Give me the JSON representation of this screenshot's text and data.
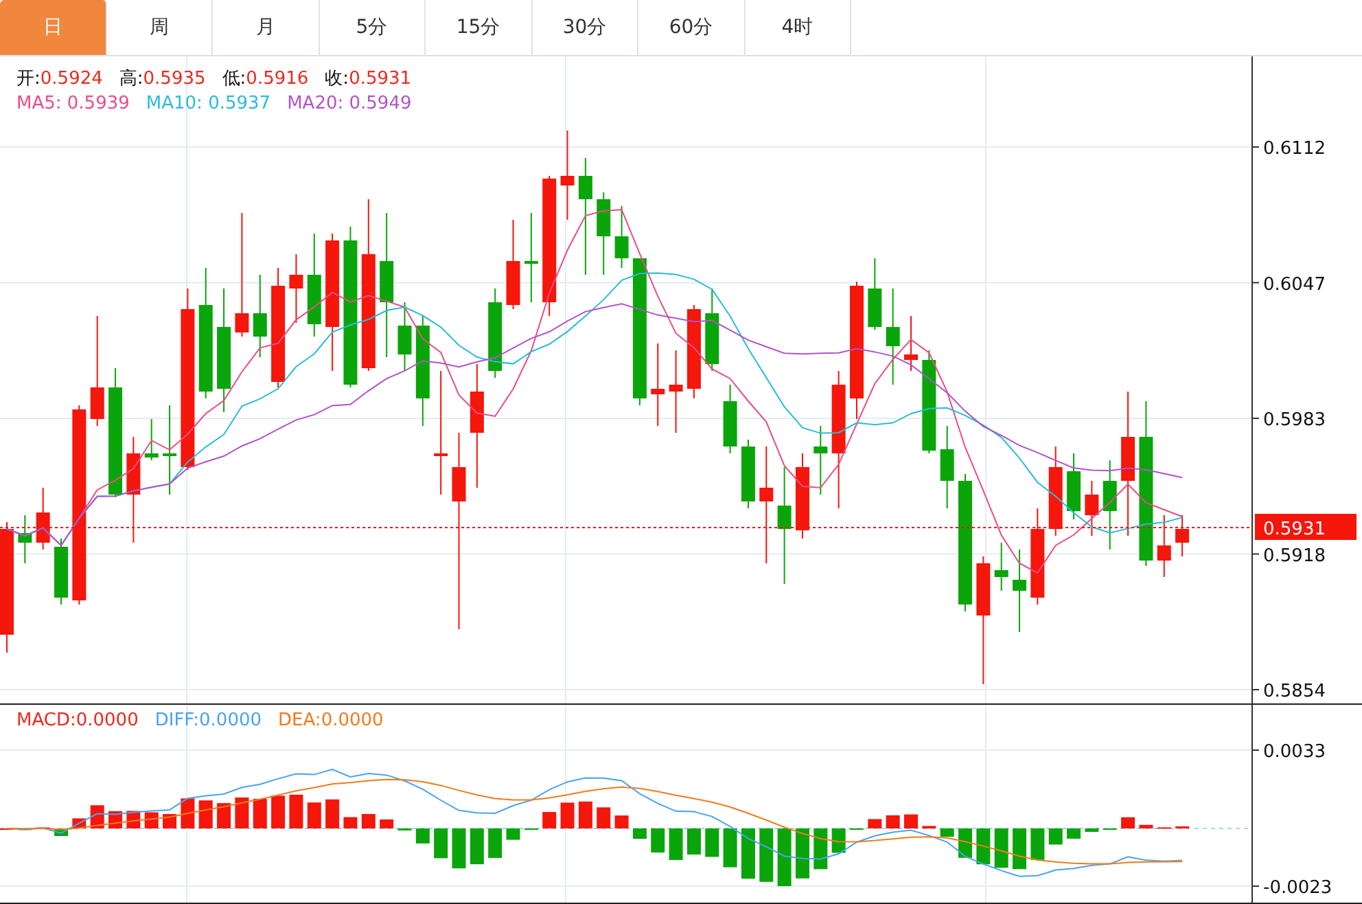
{
  "tabs": [
    {
      "label": "日",
      "selected": true
    },
    {
      "label": "周",
      "selected": false
    },
    {
      "label": "月",
      "selected": false
    },
    {
      "label": "5分",
      "selected": false
    },
    {
      "label": "15分",
      "selected": false
    },
    {
      "label": "30分",
      "selected": false
    },
    {
      "label": "60分",
      "selected": false
    },
    {
      "label": "4时",
      "selected": false
    }
  ],
  "price_panel": {
    "ohlc": [
      {
        "label": "开:",
        "value": "0.5924"
      },
      {
        "label": "高:",
        "value": "0.5935"
      },
      {
        "label": "低:",
        "value": "0.5916"
      },
      {
        "label": "收:",
        "value": "0.5931"
      }
    ],
    "moving_averages": [
      {
        "label": "MA5:",
        "value": "0.5939",
        "color": "#ea4c89"
      },
      {
        "label": "MA10:",
        "value": "0.5937",
        "color": "#2bbcd6"
      },
      {
        "label": "MA20:",
        "value": "0.5949",
        "color": "#b154c8"
      }
    ],
    "y_ticks": [
      "0.6112",
      "0.6047",
      "0.5983",
      "0.5918",
      "0.5854"
    ],
    "last_price": "0.5931"
  },
  "macd_panel": {
    "indicators": [
      {
        "label": "MACD:",
        "value": "0.0000",
        "color": "#f0281c"
      },
      {
        "label": "DIFF:",
        "value": "0.0000",
        "color": "#4aa3f0"
      },
      {
        "label": "DEA:",
        "value": "0.0000",
        "color": "#f37b1d"
      }
    ],
    "y_ticks": [
      "0.0033",
      "-0.0023"
    ]
  }
}
